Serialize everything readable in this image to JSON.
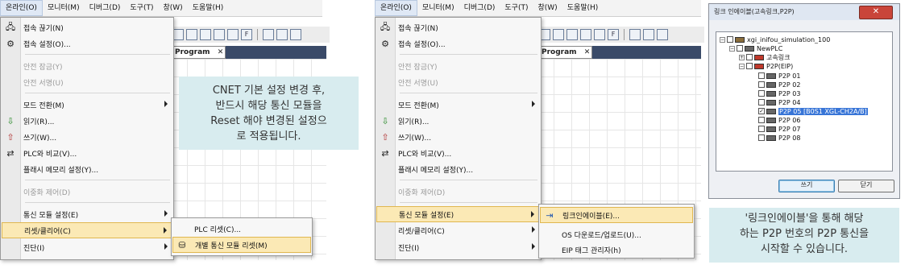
{
  "menubar": {
    "items": [
      "온라인(O)",
      "모니터(M)",
      "디버그(D)",
      "도구(T)",
      "창(W)",
      "도움말(H)"
    ]
  },
  "tab": {
    "label": "Program",
    "close": "✕"
  },
  "online_menu": {
    "items": [
      {
        "label": "접속 끊기(N)",
        "icon": "disconnect-icon",
        "enabled": true
      },
      {
        "label": "접속 설정(O)...",
        "icon": "connection-settings-icon",
        "enabled": true
      },
      {
        "label": "안전 잠금(Y)",
        "enabled": false
      },
      {
        "label": "안전 서명(U)",
        "enabled": false
      },
      {
        "label": "모드 전환(M)",
        "enabled": true,
        "submenu": true
      },
      {
        "label": "읽기(R)...",
        "icon": "read-icon",
        "enabled": true
      },
      {
        "label": "쓰기(W)...",
        "icon": "write-icon",
        "enabled": true
      },
      {
        "label": "PLC와 비교(V)...",
        "icon": "compare-icon",
        "enabled": true
      },
      {
        "label": "플래시 메모리 설정(Y)...",
        "enabled": true
      },
      {
        "label": "이중화 제어(D)",
        "enabled": false
      },
      {
        "label": "통신 모듈 설정(E)",
        "enabled": true,
        "submenu": true
      },
      {
        "label": "리셋/클리어(C)",
        "enabled": true,
        "submenu": true
      },
      {
        "label": "진단(I)",
        "enabled": true,
        "submenu": true
      }
    ]
  },
  "reset_submenu": {
    "items": [
      {
        "label": "PLC 리셋(C)..."
      },
      {
        "label": "개별 통신 모듈 리셋(M)",
        "icon": "module-reset-icon"
      }
    ]
  },
  "comm_submenu": {
    "items": [
      {
        "label": "링크인에이블(E)...",
        "icon": "link-enable-icon"
      },
      {
        "label": "OS 다운로드/업로드(U)..."
      },
      {
        "label": "EIP 태그 관리자(h)"
      }
    ]
  },
  "callout1": {
    "lines": [
      "CNET 기본 설정 변경 후,",
      "반드시 해당 통신 모듈을",
      "Reset 해야 변경된 설정으",
      "로 적용됩니다."
    ]
  },
  "dialog": {
    "title": "링크 인에이블(고속링크,P2P)",
    "close": "✕",
    "tree": [
      {
        "label": "xgi_inifou_simulation_100",
        "level": 0
      },
      {
        "label": "NewPLC",
        "level": 1
      },
      {
        "label": "고속링크",
        "level": 2
      },
      {
        "label": "P2P(EIP)",
        "level": 2
      },
      {
        "label": "P2P 01",
        "level": 3
      },
      {
        "label": "P2P 02",
        "level": 3
      },
      {
        "label": "P2P 03",
        "level": 3
      },
      {
        "label": "P2P 04",
        "level": 3
      },
      {
        "label": "P2P 05 [B0S1 XGL-CH2A/B]",
        "level": 3,
        "checked": true,
        "selected": true
      },
      {
        "label": "P2P 06",
        "level": 3
      },
      {
        "label": "P2P 07",
        "level": 3
      },
      {
        "label": "P2P 08",
        "level": 3
      }
    ],
    "write_button": "쓰기",
    "close_button": "닫기"
  },
  "callout2": {
    "lines": [
      "'링크인에이블'을 통해 해당",
      "하는 P2P 번호의 P2P 통신을",
      "시작할 수 있습니다."
    ]
  }
}
